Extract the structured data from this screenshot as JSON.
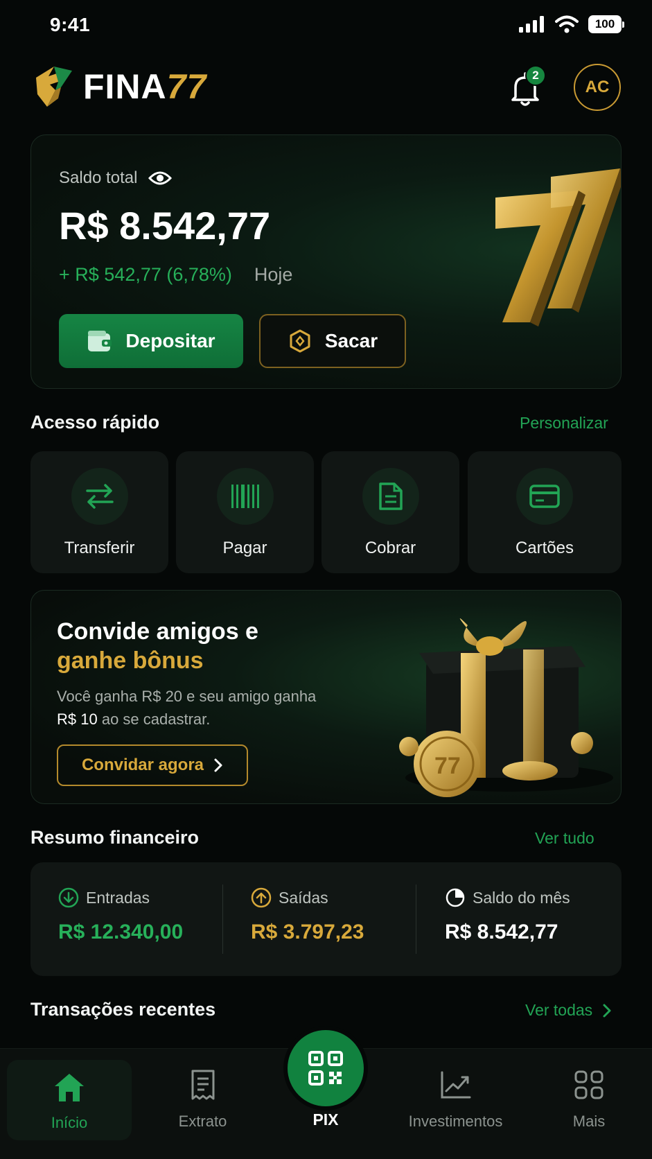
{
  "status_bar": {
    "time": "9:41",
    "battery": "100"
  },
  "header": {
    "brand_main": "FINA",
    "brand_accent": "77",
    "notification_count": "2",
    "avatar_initials": "AC"
  },
  "balance": {
    "label": "Saldo total",
    "value": "R$ 8.542,77",
    "change": "+ R$ 542,77 (6,78%)",
    "period": "Hoje",
    "deposit_label": "Depositar",
    "withdraw_label": "Sacar"
  },
  "quick_access": {
    "title": "Acesso rápido",
    "action": "Personalizar",
    "items": [
      {
        "label": "Transferir",
        "icon": "transfer-icon"
      },
      {
        "label": "Pagar",
        "icon": "barcode-icon"
      },
      {
        "label": "Cobrar",
        "icon": "document-icon"
      },
      {
        "label": "Cartões",
        "icon": "card-icon"
      }
    ]
  },
  "invite": {
    "title_line1": "Convide amigos e",
    "title_line2": "ganhe bônus",
    "desc_part1": "Você ganha R$ 20 e seu amigo ganha ",
    "desc_bold": "R$ 10",
    "desc_part2": " ao se cadastrar.",
    "button": "Convidar agora"
  },
  "summary": {
    "title": "Resumo financeiro",
    "action": "Ver tudo",
    "income_label": "Entradas",
    "income_value": "R$ 12.340,00",
    "expense_label": "Saídas",
    "expense_value": "R$ 3.797,23",
    "month_label": "Saldo do mês",
    "month_value": "R$ 8.542,77"
  },
  "transactions": {
    "title": "Transações recentes",
    "action": "Ver todas"
  },
  "nav": {
    "home": "Início",
    "statement": "Extrato",
    "pix": "PIX",
    "investments": "Investimentos",
    "more": "Mais"
  },
  "colors": {
    "accent_green": "#22a455",
    "accent_gold": "#d8a93b",
    "background": "#050807"
  }
}
